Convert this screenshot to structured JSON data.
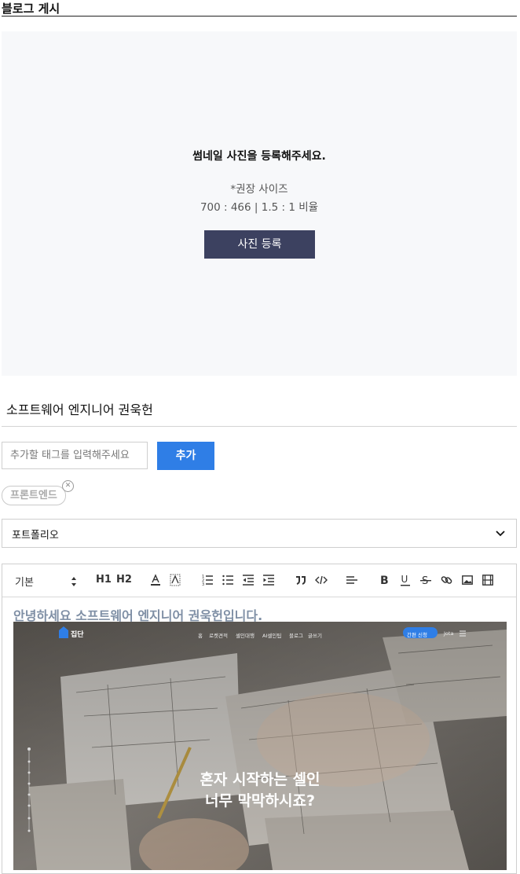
{
  "page": {
    "title": "블로그 게시"
  },
  "thumbnail": {
    "message": "썸네일 사진을 등록해주세요.",
    "hint_line1": "*권장 사이즈",
    "hint_line2": "700 : 466 | 1.5 : 1 비율",
    "button_label": "사진 등록"
  },
  "post": {
    "title_value": "소프트웨어 엔지니어 권욱헌"
  },
  "tags": {
    "placeholder": "추가할 태그를 입력해주세요",
    "add_label": "추가",
    "items": [
      {
        "label": "프론트엔드"
      }
    ]
  },
  "category": {
    "selected": "포트폴리오"
  },
  "editor": {
    "toolbar": {
      "block_style": "기본",
      "h1": "H1",
      "h2": "H2"
    },
    "content_heading": "안녕하세요 소프트웨어 엔지니어 권욱헌입니다.",
    "embedded_image": {
      "logo_text": "집단",
      "nav": [
        "홈",
        "로켓견적",
        "셀인대행",
        "AI셀인팁",
        "블로그",
        "글쓰기"
      ],
      "cta": "간편 신청",
      "user": "Jota",
      "headline_line1": "혼자 시작하는 셀인",
      "headline_line2": "너무 막막하시죠?"
    }
  },
  "colors": {
    "primary_button": "#2f7ee6",
    "dark_button": "#3c4160",
    "heading_gray": "#7f8fa5"
  }
}
